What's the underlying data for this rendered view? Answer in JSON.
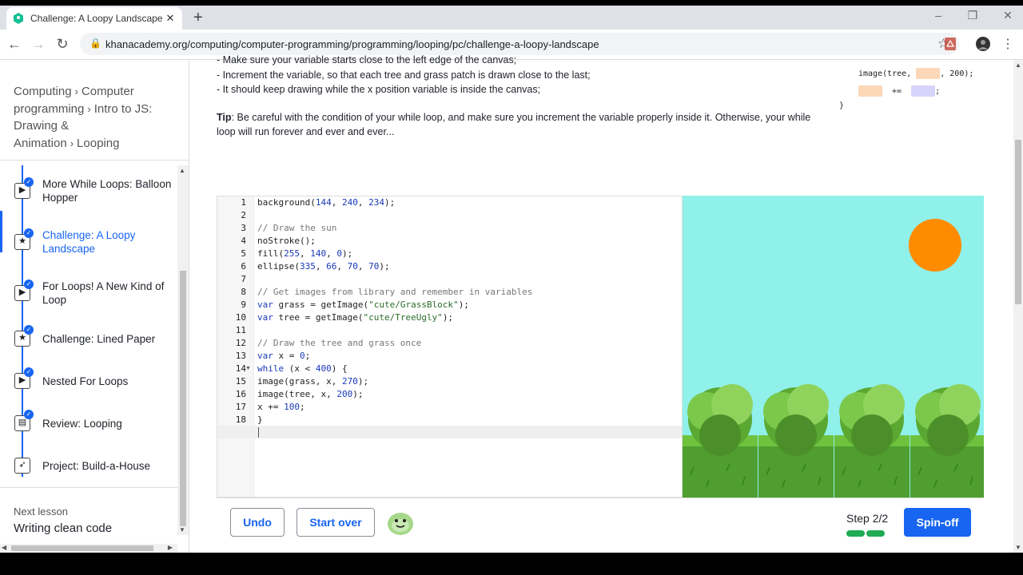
{
  "browser": {
    "tab_title": "Challenge: A Loopy Landscape | K",
    "url": "khanacademy.org/computing/computer-programming/programming/looping/pc/challenge-a-loopy-landscape",
    "new_tab": "+",
    "close": "✕",
    "back": "←",
    "forward": "→",
    "reload": "↻"
  },
  "breadcrumbs": {
    "items": [
      "Computing",
      "Computer programming",
      "Intro to JS: Drawing & Animation",
      "Looping"
    ],
    "separator": "›"
  },
  "lessons": [
    {
      "label": "More While Loops: Balloon Hopper",
      "icon": "play-icon",
      "completed": true
    },
    {
      "label": "Challenge: A Loopy Landscape",
      "icon": "star-icon",
      "completed": true,
      "active": true
    },
    {
      "label": "For Loops! A New Kind of Loop",
      "icon": "play-icon",
      "completed": true
    },
    {
      "label": "Challenge: Lined Paper",
      "icon": "star-icon",
      "completed": true
    },
    {
      "label": "Nested For Loops",
      "icon": "play-icon",
      "completed": true
    },
    {
      "label": "Review: Looping",
      "icon": "document-icon",
      "completed": true
    },
    {
      "label": "Project: Build-a-House",
      "icon": "rocket-icon",
      "completed": false
    }
  ],
  "next_lesson": {
    "heading": "Next lesson",
    "title": "Writing clean code"
  },
  "instructions": {
    "cut_line": "- Make sure your variable starts close to the left edge of the canvas;",
    "bullet1": "- Increment the variable, so that each tree and grass patch is drawn close to the last;",
    "bullet2": "- It should keep drawing while the x position variable is inside the canvas;",
    "tip_label": "Tip",
    "tip_text": ": Be careful with the condition of your while loop, and make sure you increment the variable properly inside it. Otherwise, your while loop will run forever and ever and ever..."
  },
  "hint_code": {
    "line1_start": "image(tree, ",
    "line1_end": ", 200);",
    "line2_op": "+=",
    "line2_end": ";",
    "closing_brace": "}"
  },
  "editor": {
    "line_numbers": [
      "1",
      "2",
      "3",
      "4",
      "5",
      "6",
      "7",
      "8",
      "9",
      "10",
      "11",
      "12",
      "13",
      "14",
      "15",
      "16",
      "17",
      "18",
      "19"
    ],
    "lines": [
      "background(144, 240, 234);",
      "",
      "// Draw the sun",
      "noStroke();",
      "fill(255, 140, 0);",
      "ellipse(335, 66, 70, 70);",
      "",
      "// Get images from library and remember in variables",
      "var grass = getImage(\"cute/GrassBlock\");",
      "var tree = getImage(\"cute/TreeUgly\");",
      "",
      "// Draw the tree and grass once",
      "var x = 0;",
      "while (x < 400) {",
      "image(grass, x, 270);",
      "image(tree, x, 200);",
      "x += 100;",
      "}",
      ""
    ]
  },
  "canvas": {
    "background": "#90f0ea",
    "sun_color": "#ff8c00"
  },
  "bottom": {
    "undo": "Undo",
    "start_over": "Start over",
    "step": "Step 2/2",
    "spinoff": "Spin-off"
  },
  "colors": {
    "accent": "#1865f2",
    "progress": "#1fab54"
  }
}
